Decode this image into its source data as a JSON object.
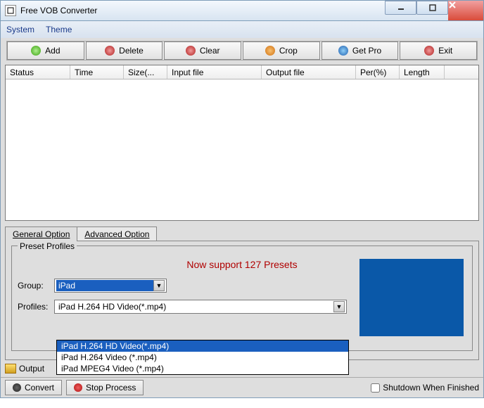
{
  "window": {
    "title": "Free VOB Converter"
  },
  "menubar": {
    "items": [
      "System",
      "Theme"
    ]
  },
  "toolbar": {
    "add": "Add",
    "delete": "Delete",
    "clear": "Clear",
    "crop": "Crop",
    "getpro": "Get Pro",
    "exit": "Exit"
  },
  "table": {
    "columns": {
      "status": "Status",
      "time": "Time",
      "size": "Size(...",
      "input": "Input file",
      "output": "Output file",
      "per": "Per(%)",
      "length": "Length"
    }
  },
  "tabs": {
    "general": "General Option",
    "advanced": "Advanced Option"
  },
  "preset": {
    "legend": "Preset Profiles",
    "support": "Now support 127 Presets",
    "group_label": "Group:",
    "group_value": "iPad",
    "profiles_label": "Profiles:",
    "profiles_value": "iPad H.264 HD Video(*.mp4)",
    "options": [
      "iPad H.264 HD Video(*.mp4)",
      "iPad H.264 Video (*.mp4)",
      "iPad MPEG4 Video (*.mp4)"
    ]
  },
  "output": {
    "label": "Output"
  },
  "bottom": {
    "convert": "Convert",
    "stop": "Stop Process",
    "shutdown": "Shutdown When Finished"
  }
}
